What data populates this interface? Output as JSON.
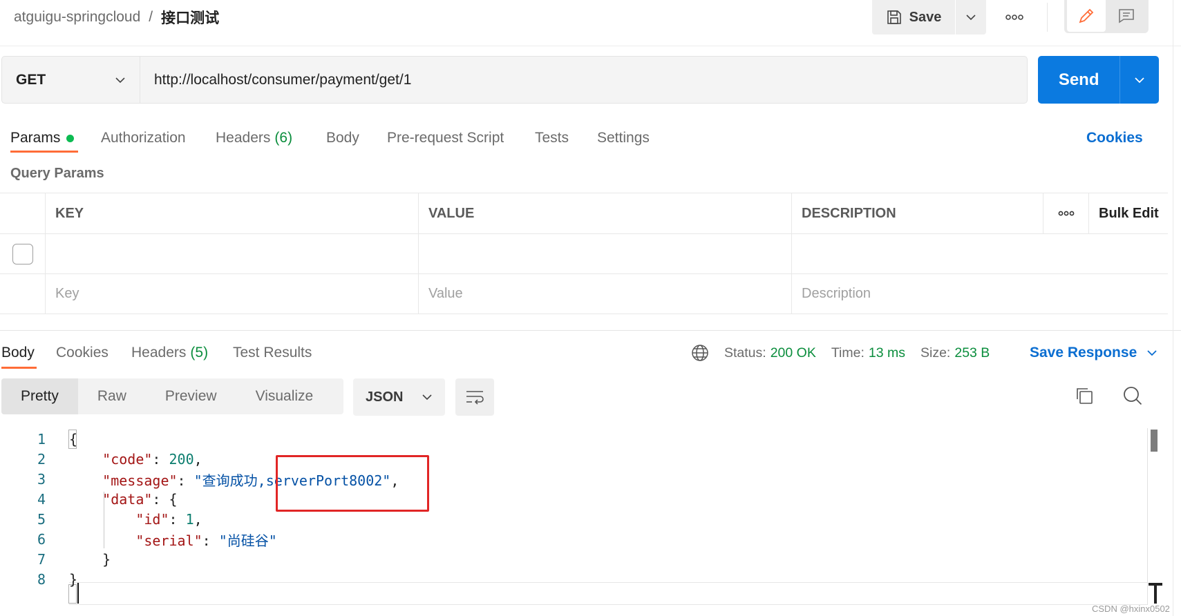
{
  "header": {
    "workspace": "atguigu-springcloud",
    "separator": "/",
    "request_name": "接口测试",
    "save_label": "Save"
  },
  "request": {
    "method": "GET",
    "url": "http://localhost/consumer/payment/get/1",
    "send_label": "Send"
  },
  "request_tabs": {
    "params": "Params",
    "authorization": "Authorization",
    "headers": "Headers",
    "headers_count": "(6)",
    "body": "Body",
    "pre_request": "Pre-request Script",
    "tests": "Tests",
    "settings": "Settings",
    "cookies": "Cookies"
  },
  "query_params": {
    "title": "Query Params",
    "columns": {
      "key": "KEY",
      "value": "VALUE",
      "description": "DESCRIPTION",
      "bulk_edit": "Bulk Edit"
    },
    "placeholders": {
      "key": "Key",
      "value": "Value",
      "description": "Description"
    }
  },
  "response_tabs": {
    "body": "Body",
    "cookies": "Cookies",
    "headers": "Headers",
    "headers_count": "(5)",
    "test_results": "Test Results"
  },
  "response_meta": {
    "status_label": "Status:",
    "status_value": "200 OK",
    "time_label": "Time:",
    "time_value": "13 ms",
    "size_label": "Size:",
    "size_value": "253 B",
    "save_response": "Save Response"
  },
  "view_modes": {
    "pretty": "Pretty",
    "raw": "Raw",
    "preview": "Preview",
    "visualize": "Visualize",
    "language": "JSON"
  },
  "code": {
    "line_numbers": [
      "1",
      "2",
      "3",
      "4",
      "5",
      "6",
      "7",
      "8"
    ],
    "open_brace": "{",
    "code_key": "\"code\"",
    "code_value": "200",
    "message_key": "\"message\"",
    "message_value_part1": "\"查询成功,",
    "message_value_part2": "serverPort8002\"",
    "data_key": "\"data\"",
    "id_key": "\"id\"",
    "id_value": "1",
    "serial_key": "\"serial\"",
    "serial_value": "\"尚硅谷\"",
    "inner_close": "}",
    "outer_close": "}"
  },
  "watermark": "CSDN @hxinx0502",
  "colors": {
    "send_blue": "#0b7ae0",
    "active_tab_orange": "#ff6c37",
    "status_green": "#0a8d3c",
    "link_blue": "#0b6ed1",
    "highlight_red": "#e12525"
  },
  "icons": [
    "save-icon",
    "chevron-down-icon",
    "more-icon",
    "pencil-icon",
    "comment-icon",
    "globe-icon",
    "wrap-lines-icon",
    "copy-icon",
    "search-icon"
  ]
}
